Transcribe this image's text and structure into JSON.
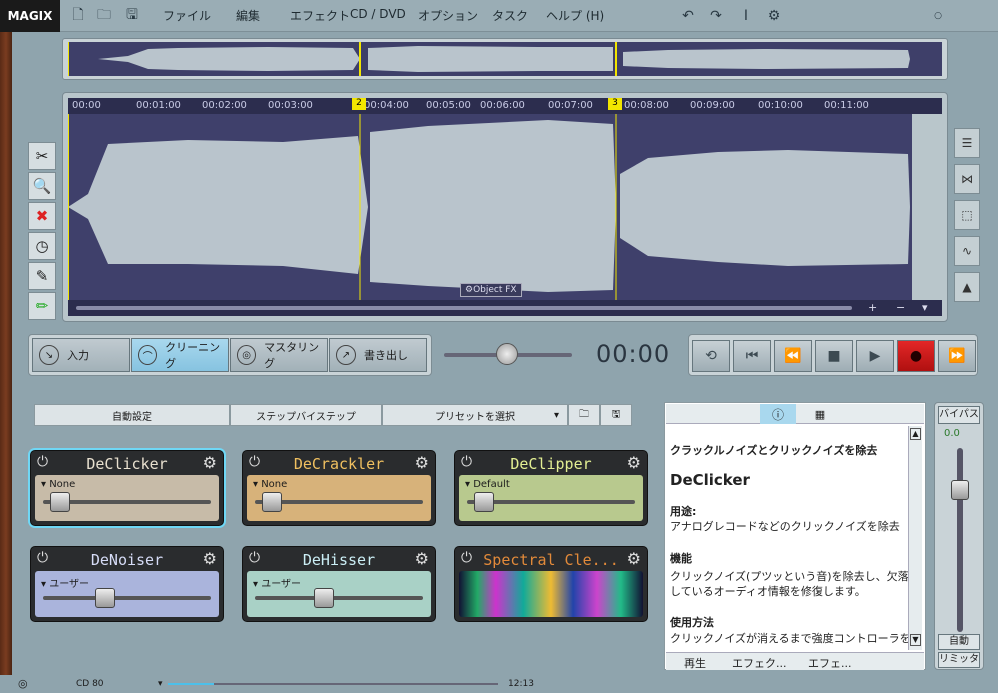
{
  "app": {
    "logo": "MAGIX"
  },
  "menu": [
    "ファイル",
    "編集",
    "エフェクト",
    "CD / DVD",
    "オプション",
    "タスク",
    "ヘルプ (H)"
  ],
  "icons": {
    "new": "new-file-icon",
    "open": "open-folder-icon",
    "save": "save-icon",
    "undo": "undo-icon",
    "redo": "redo-icon",
    "cursor": "cursor-icon",
    "settings": "settings-icon"
  },
  "ruler": {
    "ticks": [
      "00:00",
      "00:01:00",
      "00:02:00",
      "00:03:00",
      "00:04:00",
      "00:05:00",
      "00:06:00",
      "00:07:00",
      "00:08:00",
      "00:09:00",
      "00:10:00",
      "00:11:00"
    ],
    "markers": [
      "2",
      "3"
    ]
  },
  "object_fx": "Object FX",
  "scroll_controls": [
    "+",
    "−",
    "▾"
  ],
  "modes": [
    {
      "label": "入力",
      "active": false
    },
    {
      "label": "クリーニング",
      "active": true
    },
    {
      "label": "マスタリング",
      "active": false
    },
    {
      "label": "書き出し",
      "active": false
    }
  ],
  "time_display": "00:00",
  "toolbar": {
    "auto": "自動設定",
    "step": "ステップバイステップ",
    "preset": "プリセットを選択"
  },
  "effects": [
    {
      "name": "DeClicker",
      "preset": "None",
      "color": "#c7bba8",
      "text": "#e8e0cf",
      "level": 0.05,
      "selected": true
    },
    {
      "name": "DeCrackler",
      "preset": "None",
      "color": "#d7b27a",
      "text": "#f0c060",
      "level": 0.05,
      "selected": false
    },
    {
      "name": "DeClipper",
      "preset": "Default",
      "color": "#b8c98e",
      "text": "#e3ef93",
      "level": 0.05,
      "selected": false
    },
    {
      "name": "DeNoiser",
      "preset": "ユーザー",
      "color": "#aab4dc",
      "text": "#d6dcf7",
      "level": 0.35,
      "selected": false
    },
    {
      "name": "DeHisser",
      "preset": "ユーザー",
      "color": "#a9d1c6",
      "text": "#cbeef5",
      "level": 0.4,
      "selected": false
    },
    {
      "name": "Spectral Cle...",
      "preset": "",
      "color": "#1a2340",
      "text": "#e28a3a",
      "level": 0,
      "selected": false
    }
  ],
  "info": {
    "heading": "クラックルノイズとクリックノイズを除去",
    "title": "DeClicker",
    "use_label": "用途:",
    "use_text": "アナログレコードなどのクリックノイズを除去",
    "func_label": "機能",
    "func_text1": "クリックノイズ(プツッという音)を除去し、欠落",
    "func_text2": "しているオーディオ情報を修復します。",
    "how_label": "使用方法",
    "how_text": "クリックノイズが消えるまで強度コントローラを",
    "bottom": [
      "再生",
      "エフェク...",
      "エフェ..."
    ]
  },
  "right_panel": {
    "bypass": "バイパス",
    "value": "0.0",
    "auto": "自動",
    "limiter": "リミッタ"
  },
  "status": {
    "cd": "CD 80",
    "time": "12:13"
  }
}
